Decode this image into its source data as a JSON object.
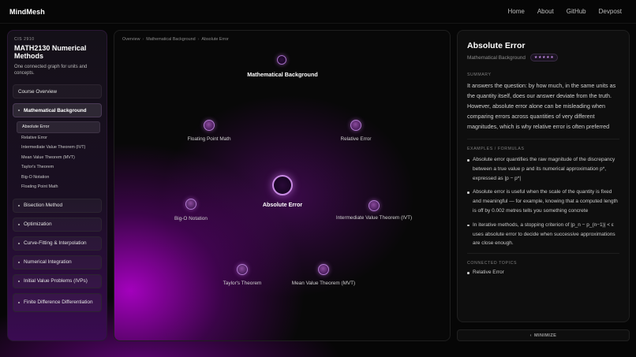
{
  "app": {
    "brand": "MindMesh"
  },
  "nav": {
    "items": [
      "Home",
      "About",
      "GitHub",
      "Devpost"
    ]
  },
  "sidebar": {
    "course_code": "CIS 2910",
    "course_title": "MATH2130 Numerical Methods",
    "course_desc": "One connected graph for units and concepts.",
    "overview_label": "Course Overview",
    "active_unit": "Mathematical Background",
    "subitems": [
      "Absolute Error",
      "Relative Error",
      "Intermediate Value Theorem (IVT)",
      "Mean Value Theorem (MVT)",
      "Taylor's Theorem",
      "Big-O Notation",
      "Floating Point Math"
    ],
    "active_subitem_index": 0,
    "units": [
      "Bisection Method",
      "Optimization",
      "Curve-Fitting & Interpolation",
      "Numerical Integration",
      "Initial Value Problems (IVPs)",
      "Finite Difference Differentiation"
    ]
  },
  "graph": {
    "breadcrumb": [
      "Overview",
      "Mathematical Background",
      "Absolute Error"
    ],
    "nodes": {
      "root": "Mathematical Background",
      "center": "Absolute Error",
      "floating": "Floating Point Math",
      "relative": "Relative Error",
      "bigo": "Big-O Notation",
      "ivt": "Intermediate Value Theorem (IVT)",
      "taylor": "Taylor's Theorem",
      "mvt": "Mean Value Theorem (MVT)"
    }
  },
  "detail": {
    "title": "Absolute Error",
    "unit": "Mathematical Background",
    "rating": "★★★★★",
    "summary_heading": "SUMMARY",
    "summary": "It answers the question: by how much, in the same units as the quantity itself, does our answer deviate from the truth. However, absolute error alone can be misleading when comparing errors across quantities of very different magnitudes, which is why relative error is often preferred",
    "examples_heading": "EXAMPLES / FORMULAS",
    "examples": [
      "Absolute error quantifies the raw magnitude of the discrepancy between a true value p and its numerical approximation p*, expressed as |p − p*|",
      "Absolute error is useful when the scale of the quantity is fixed and meaningful — for example, knowing that a computed length is off by 0.002 metres tells you something concrete",
      "In iterative methods, a stopping criterion of |p_n − p_(n−1)| < ε uses absolute error to decide when successive approximations are close enough."
    ],
    "connected_heading": "CONNECTED TOPICS",
    "connected": [
      "Relative Error"
    ]
  },
  "footer": {
    "minimize_label": "MINIMIZE",
    "minimize_glyph": "‹"
  }
}
